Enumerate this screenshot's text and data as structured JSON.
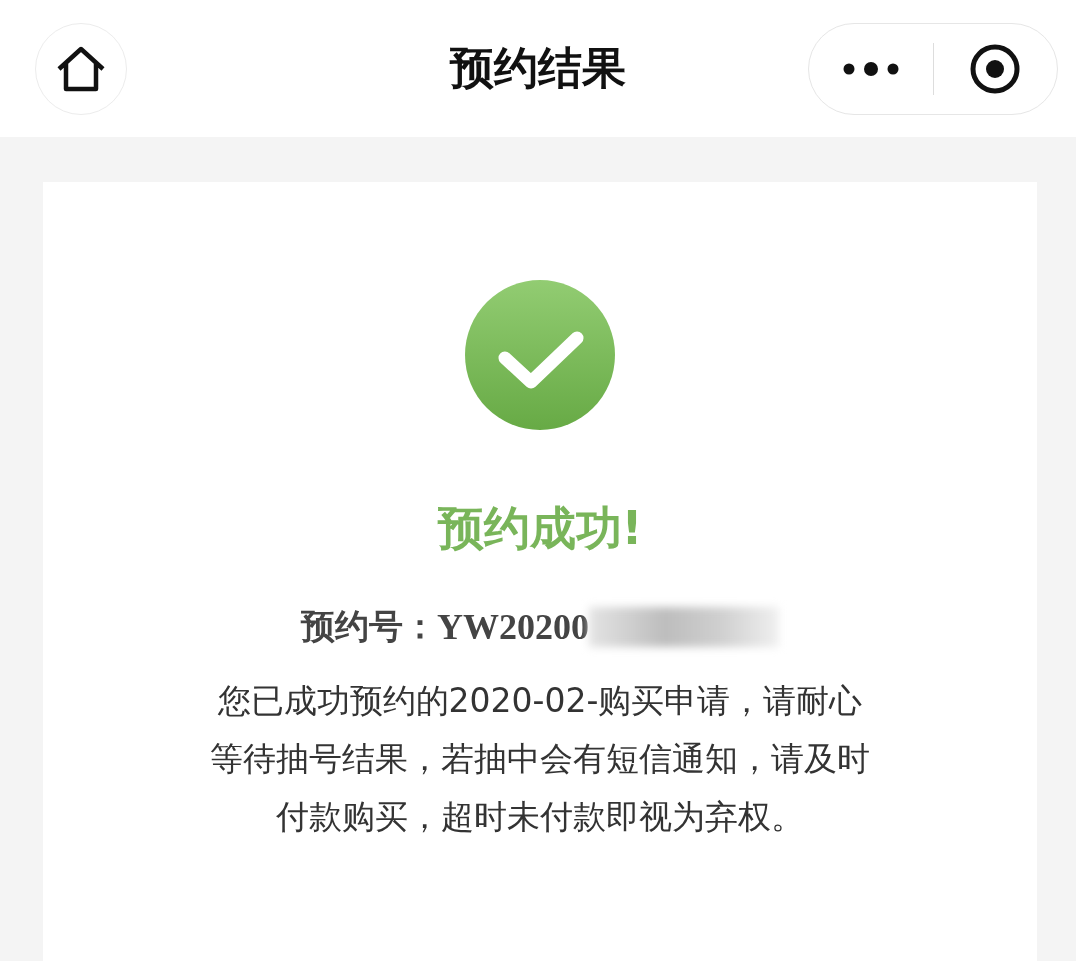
{
  "header": {
    "title": "预约结果"
  },
  "result": {
    "title": "预约成功!",
    "order_label": "预约号：",
    "order_number": "YW20200",
    "order_redacted": true,
    "message_lines": [
      "您已成功预约的2020-02-购买申请，请耐心",
      "等待抽号结果，若抽中会有短信通知，请及时",
      "付款购买，超时未付款即视为弃权。"
    ]
  }
}
